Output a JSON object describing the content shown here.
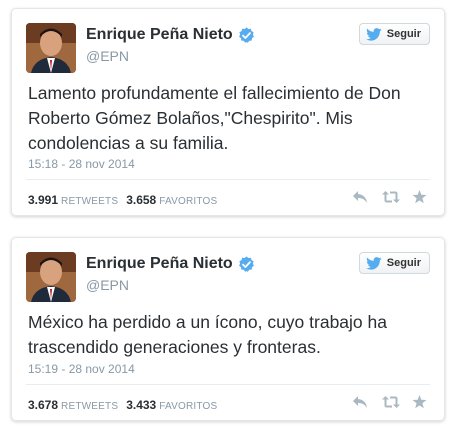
{
  "tweets": [
    {
      "name": "Enrique Peña Nieto",
      "handle": "@EPN",
      "follow_label": "Seguir",
      "text": "Lamento profundamente el fallecimiento de Don Roberto Gómez Bolaños,\"Chespirito\". Mis condolencias a su familia.",
      "date": "15:18 - 28 nov 2014",
      "retweets": "3.991",
      "retweets_label": "RETWEETS",
      "favorites": "3.658",
      "favorites_label": "FAVORITOS"
    },
    {
      "name": "Enrique Peña Nieto",
      "handle": "@EPN",
      "follow_label": "Seguir",
      "text": "México ha perdido a un ícono, cuyo trabajo ha trascendido generaciones y fronteras.",
      "date": "15:19 - 28 nov 2014",
      "retweets": "3.678",
      "retweets_label": "RETWEETS",
      "favorites": "3.433",
      "favorites_label": "FAVORITOS"
    }
  ],
  "icons": {
    "verified": "verified-badge-icon",
    "bird": "twitter-bird-icon",
    "reply": "reply-icon",
    "retweet": "retweet-icon",
    "favorite": "star-icon"
  },
  "colors": {
    "verified": "#55acee",
    "bird": "#55acee",
    "muted": "#8899a6",
    "text": "#292f33",
    "action_icon": "#aab8c2"
  }
}
